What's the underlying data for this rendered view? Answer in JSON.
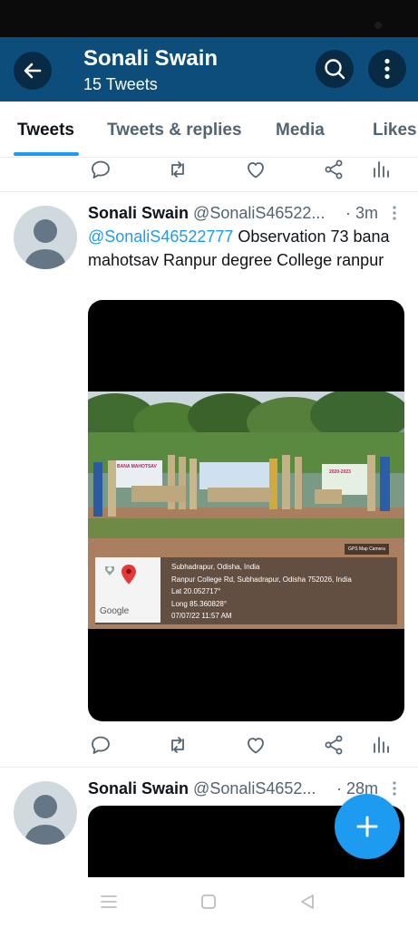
{
  "header": {
    "title": "Sonali Swain",
    "subtitle": "15 Tweets",
    "back_icon": "arrow-left-icon",
    "search_icon": "search-icon",
    "more_icon": "more-vertical-icon",
    "color": "#0d4d7c"
  },
  "tabs": [
    {
      "label": "Tweets",
      "active": true
    },
    {
      "label": "Tweets & replies",
      "active": false
    },
    {
      "label": "Media",
      "active": false
    },
    {
      "label": "Likes",
      "active": false
    }
  ],
  "tweets": [
    {
      "name": "Sonali Swain",
      "handle": "@SonaliS46522...",
      "time": "· 3m",
      "mention": "@SonaliS46522777",
      "text_after_mention": " Observation 73 bana mahotsav Ranpur degree College ranpur",
      "photo": {
        "banners": [
          "BANA MAHOTSAV",
          "",
          "2020-2023"
        ],
        "camera_tag": "GPS Map Camera",
        "map_brand": "Google",
        "gps_lines": [
          "Subhadrapur, Odisha, India",
          "Ranpur College Rd, Subhadrapur, Odisha 752026, India",
          "Lat 20.052717°",
          "Long 85.360828°",
          "07/07/22 11:57 AM"
        ]
      }
    },
    {
      "name": "Sonali Swain",
      "handle": "@SonaliS4652...",
      "time": "· 28m"
    }
  ],
  "action_icons": [
    "reply-icon",
    "retweet-icon",
    "like-icon",
    "share-icon",
    "analytics-icon"
  ],
  "fab": {
    "icon": "plus-icon",
    "color": "#1d9bf0"
  },
  "navbar": {
    "icons": [
      "menu-icon",
      "home-icon",
      "back-triangle-icon"
    ]
  }
}
